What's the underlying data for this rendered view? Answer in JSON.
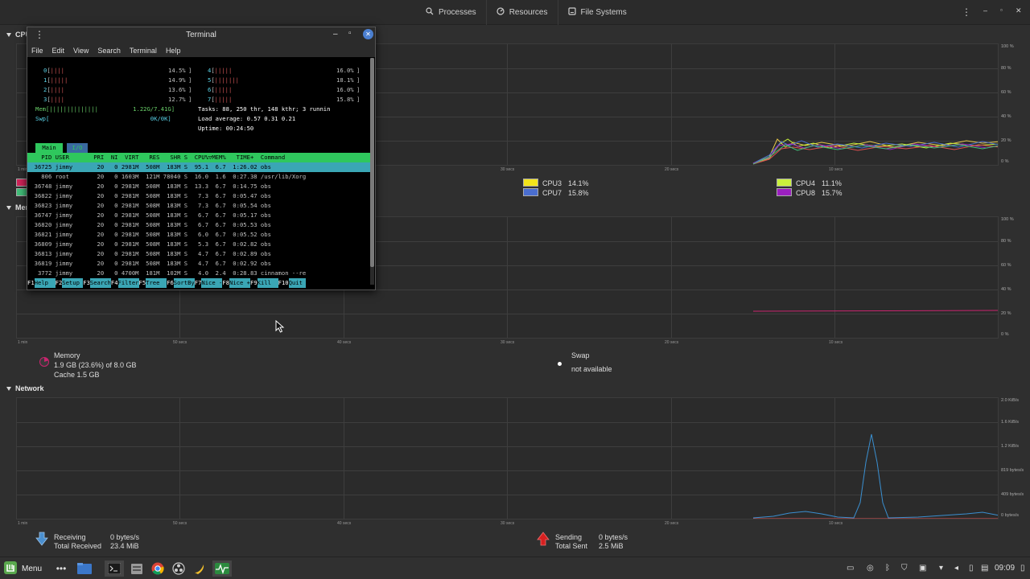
{
  "header": {
    "tabs": [
      {
        "label": "Processes",
        "icon": "search-icon"
      },
      {
        "label": "Resources",
        "icon": "gauge-icon"
      },
      {
        "label": "File Systems",
        "icon": "disk-icon"
      }
    ]
  },
  "sections": {
    "cpu_title": "CPU",
    "memory_title": "Memory and Swap",
    "network_title": "Network"
  },
  "axes": {
    "percent_ticks": [
      "100 %",
      "80 %",
      "60 %",
      "40 %",
      "20 %",
      "0 %"
    ],
    "time_ticks": [
      "1 min",
      "50 secs",
      "40 secs",
      "30 secs",
      "20 secs",
      "10 secs"
    ],
    "network_ticks": [
      "2.0 KiB/s",
      "1.6 KiB/s",
      "1.2 KiB/s",
      "819 bytes/s",
      "409 bytes/s",
      "0 bytes/s"
    ]
  },
  "cpu_legend": [
    {
      "name": "CPU3",
      "value": "14.1%",
      "color": "#f2e41b"
    },
    {
      "name": "CPU7",
      "value": "15.8%",
      "color": "#4a6ed0"
    },
    {
      "name": "CPU4",
      "value": "11.1%",
      "color": "#c9f03c"
    },
    {
      "name": "CPU8",
      "value": "15.7%",
      "color": "#9b1fc0"
    }
  ],
  "memory": {
    "label": "Memory",
    "usage": "1.9 GB (23.6%) of 8.0 GB",
    "cache": "Cache 1.5 GB",
    "swap_label": "Swap",
    "swap_value": "not available",
    "color": "#c9246e"
  },
  "network": {
    "receiving_label": "Receiving",
    "receiving_value": "0 bytes/s",
    "total_received_label": "Total Received",
    "total_received_value": "23.4 MiB",
    "sending_label": "Sending",
    "sending_value": "0 bytes/s",
    "total_sent_label": "Total Sent",
    "total_sent_value": "2.5 MiB"
  },
  "terminal": {
    "title": "Terminal",
    "menu": [
      "File",
      "Edit",
      "View",
      "Search",
      "Terminal",
      "Help"
    ],
    "meters": [
      {
        "id": "0",
        "bars": "||||",
        "pct": "14.5%"
      },
      {
        "id": "1",
        "bars": "|||||",
        "pct": "14.9%"
      },
      {
        "id": "2",
        "bars": "||||",
        "pct": "13.6%"
      },
      {
        "id": "3",
        "bars": "||||",
        "pct": "12.7%"
      },
      {
        "id": "4",
        "bars": "|||||",
        "pct": "16.0%"
      },
      {
        "id": "5",
        "bars": "|||||||",
        "pct": "18.1%"
      },
      {
        "id": "6",
        "bars": "|||||",
        "pct": "16.0%"
      },
      {
        "id": "7",
        "bars": "|||||",
        "pct": "15.8%"
      }
    ],
    "mem_line": "Mem[||||||||||||||          1.22G/7.41G]",
    "swp_line": "Swp[                             0K/0K]",
    "tasks_line": "Tasks: 88, 250 thr, 148 kthr; 3 runnin",
    "load_line": "Load average: 0.57 0.31 0.21",
    "uptime_line": "Uptime: 00:24:50",
    "tab_main": "Main",
    "tab_io": "I/O",
    "columns": "    PID USER       PRI  NI  VIRT   RES   SHR S  CPU%▽MEM%   TIME+  Command",
    "rows": [
      "  36725 jimmy       20   0 2981M  508M  183M S  95.1  6.7  1:26.02 obs",
      "    806 root        20   0 1603M  121M 78040 S  16.0  1.6  0:27.38 /usr/lib/Xorg",
      "  36748 jimmy       20   0 2981M  508M  183M S  13.3  6.7  0:14.75 obs",
      "  36822 jimmy       20   0 2981M  508M  183M S   7.3  6.7  0:05.47 obs",
      "  36823 jimmy       20   0 2981M  508M  183M S   7.3  6.7  0:05.54 obs",
      "  36747 jimmy       20   0 2981M  508M  183M S   6.7  6.7  0:05.17 obs",
      "  36820 jimmy       20   0 2981M  508M  183M S   6.7  6.7  0:05.53 obs",
      "  36821 jimmy       20   0 2981M  508M  183M S   6.0  6.7  0:05.52 obs",
      "  36809 jimmy       20   0 2981M  508M  183M S   5.3  6.7  0:02.82 obs",
      "  36813 jimmy       20   0 2981M  508M  183M S   4.7  6.7  0:02.89 obs",
      "  36819 jimmy       20   0 2981M  508M  183M S   4.7  6.7  0:02.92 obs",
      "   3772 jimmy       20   0 4700M  181M  102M S   4.0  2.4  0:28.83 cinnamon --re"
    ],
    "fkeys": [
      {
        "k": "F1",
        "l": "Help  "
      },
      {
        "k": "F2",
        "l": "Setup "
      },
      {
        "k": "F3",
        "l": "Search"
      },
      {
        "k": "F4",
        "l": "Filter"
      },
      {
        "k": "F5",
        "l": "Tree  "
      },
      {
        "k": "F6",
        "l": "SortBy"
      },
      {
        "k": "F7",
        "l": "Nice -"
      },
      {
        "k": "F8",
        "l": "Nice +"
      },
      {
        "k": "F9",
        "l": "Kill  "
      },
      {
        "k": "F10",
        "l": "Quit "
      }
    ]
  },
  "taskbar": {
    "menu_label": "Menu",
    "clock": "09:09"
  },
  "colors": {
    "accent": "#4caf50",
    "terminal_header": "#2fc75d",
    "terminal_selection": "#3aa6b5"
  }
}
